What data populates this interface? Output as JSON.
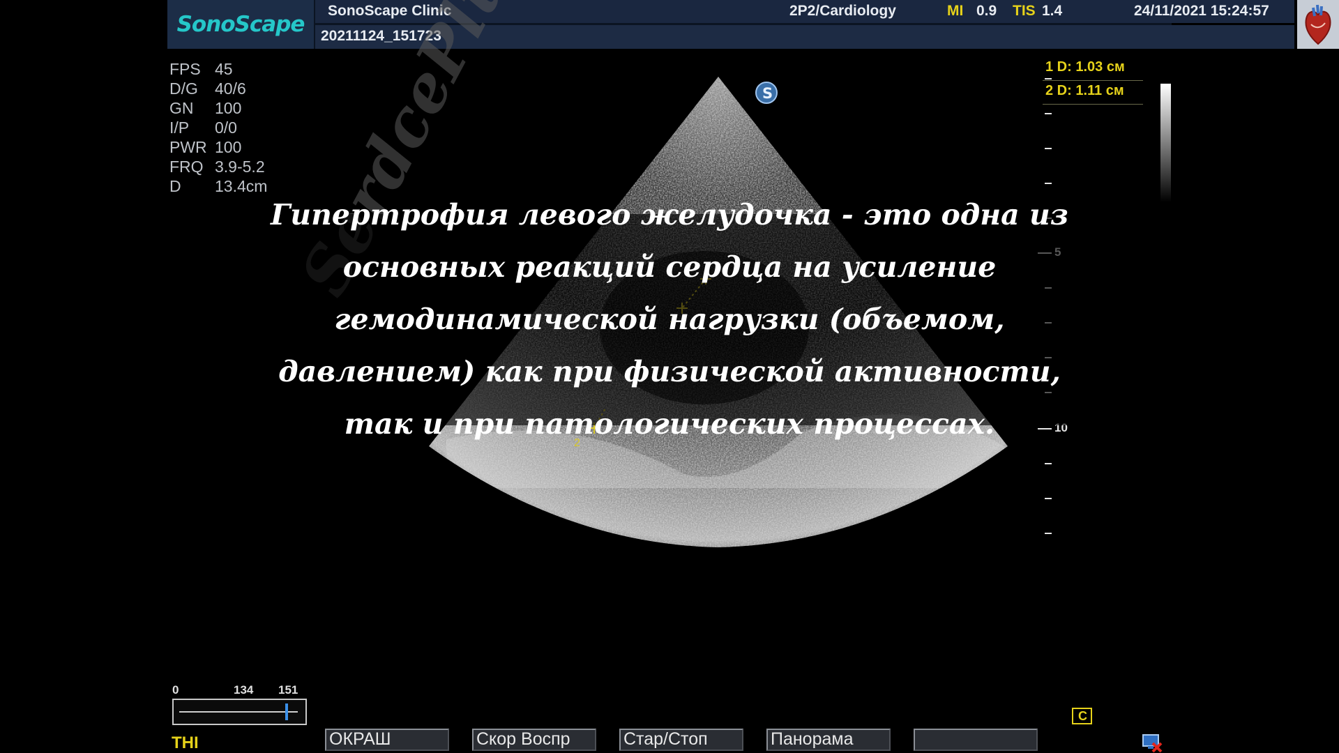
{
  "header": {
    "logo": "SonoScape",
    "clinic": "SonoScape Clinic",
    "preset": "2P2/Cardiology",
    "mi_label": "MI",
    "mi_value": "0.9",
    "tis_label": "TIS",
    "tis_value": "1.4",
    "datetime": "24/11/2021 15:24:57",
    "study_id": "20211124_151723"
  },
  "params": [
    {
      "key": "FPS",
      "value": "45"
    },
    {
      "key": "D/G",
      "value": "40/6"
    },
    {
      "key": "GN",
      "value": "100"
    },
    {
      "key": "I/P",
      "value": "0/0"
    },
    {
      "key": "PWR",
      "value": "100"
    },
    {
      "key": "FRQ",
      "value": "3.9-5.2"
    },
    {
      "key": "D",
      "value": "13.4cm"
    }
  ],
  "measurements": [
    {
      "text": "1 D: 1.03  см"
    },
    {
      "text": "2 D: 1.11  см"
    }
  ],
  "depth_labels": {
    "five": "5",
    "ten": "10"
  },
  "markers": {
    "one": "1",
    "two": "2"
  },
  "probe_icon": "S",
  "caption": "Гипертрофия левого желудочка - это одна из основных реакций сердца на усиление гемодинамической нагрузки (объемом, давлением) как при физической активности, так и при патологических процессах.",
  "watermark": "SerdcePlus.ru",
  "slider": {
    "min": "0",
    "mark": "134",
    "max": "151"
  },
  "mode_label": "THI",
  "buttons": {
    "color": "ОКРАШ",
    "playback_speed": "Скор Воспр",
    "start_stop": "Стар/Стоп",
    "panorama": "Панорама",
    "empty": ""
  },
  "icons": {
    "c_icon": "C",
    "heart": "heart-icon"
  },
  "colors": {
    "accent_yellow": "#e6d21a",
    "logo_teal": "#25c7c9"
  }
}
